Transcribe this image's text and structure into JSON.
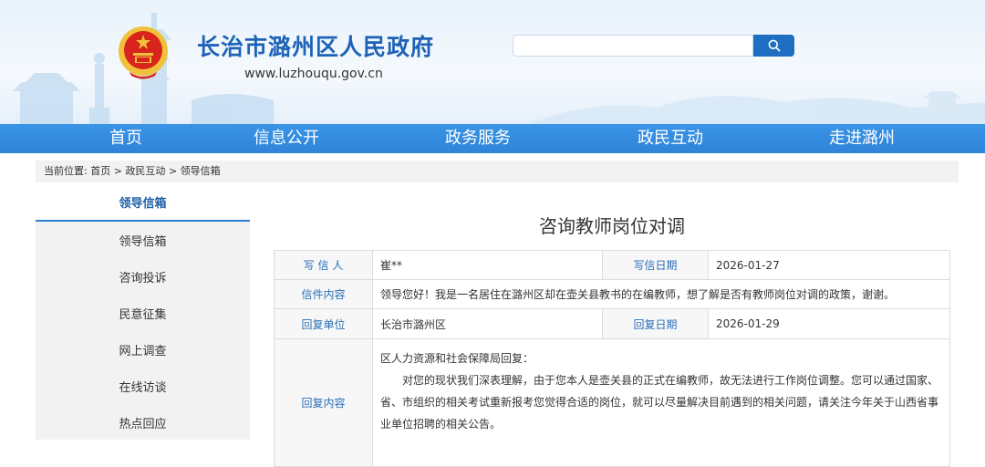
{
  "header": {
    "site_title": "长治市潞州区人民政府",
    "site_url": "www.luzhouqu.gov.cn",
    "search": {
      "value": "",
      "placeholder": ""
    }
  },
  "nav": {
    "items": [
      "首页",
      "信息公开",
      "政务服务",
      "政民互动",
      "走进潞州"
    ]
  },
  "breadcrumb": {
    "prefix": "当前位置:",
    "items": [
      "首页",
      "政民互动",
      "领导信箱"
    ],
    "separator": ">"
  },
  "sidebar": {
    "active": "领导信箱",
    "items": [
      "领导信箱",
      "咨询投诉",
      "民意征集",
      "网上调查",
      "在线访谈",
      "热点回应"
    ]
  },
  "letter": {
    "title": "咨询教师岗位对调",
    "writer_label": "写 信 人",
    "writer": "崔**",
    "date_label": "写信日期",
    "date": "2026-01-27",
    "content_label": "信件内容",
    "content": "领导您好！我是一名居住在潞州区却在壶关县教书的在编教师，想了解是否有教师岗位对调的政策，谢谢。",
    "reply_unit_label": "回复单位",
    "reply_unit": "长治市潞州区",
    "reply_date_label": "回复日期",
    "reply_date": "2026-01-29",
    "reply_content_label": "回复内容",
    "reply_heading": "区人力资源和社会保障局回复：",
    "reply_body": "对您的现状我们深表理解，由于您本人是壶关县的正式在编教师，故无法进行工作岗位调整。您可以通过国家、省、市组织的相关考试重新报考您觉得合适的岗位，就可以尽量解决目前遇到的相关问题，请关注今年关于山西省事业单位招聘的相关公告。"
  },
  "colors": {
    "nav_bg": "#3a94e6",
    "title_blue": "#1d63b6",
    "label_blue": "#2a6fb8",
    "emblem_red": "#d8241c",
    "emblem_gold": "#f0c23b"
  }
}
